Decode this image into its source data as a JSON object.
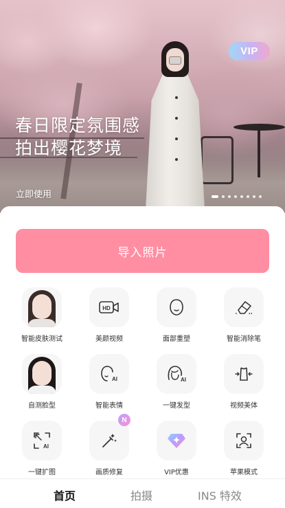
{
  "banner": {
    "title_line1": "春日限定氛围感",
    "title_line2": "拍出樱花梦境",
    "cta": "立即使用",
    "vip_label": "VIP",
    "slide_count": 8,
    "active_slide": 1
  },
  "main": {
    "import_label": "导入照片"
  },
  "tools": [
    {
      "label": "智能皮肤测试",
      "icon": "face-photo-avatar"
    },
    {
      "label": "美颜视频",
      "icon": "hd-video-icon"
    },
    {
      "label": "面部重塑",
      "icon": "face-outline-icon"
    },
    {
      "label": "智能消除笔",
      "icon": "eraser-icon"
    },
    {
      "label": "自测脸型",
      "icon": "face-photo-avatar"
    },
    {
      "label": "智能表情",
      "icon": "ai-face-icon"
    },
    {
      "label": "一键发型",
      "icon": "ai-hair-icon"
    },
    {
      "label": "视频美体",
      "icon": "body-reshape-icon"
    },
    {
      "label": "一键扩图",
      "icon": "ai-expand-icon"
    },
    {
      "label": "画质修复",
      "icon": "magic-wand-icon",
      "badge": "N"
    },
    {
      "label": "VIP优惠",
      "icon": "diamond-icon"
    },
    {
      "label": "苹果模式",
      "icon": "face-scan-icon"
    }
  ],
  "tabbar": {
    "tabs": [
      {
        "label": "首页",
        "active": true
      },
      {
        "label": "拍摄",
        "active": false
      },
      {
        "label": "INS 特效",
        "active": false
      }
    ]
  },
  "colors": {
    "accent": "#ff8ea3",
    "vip_gradient": [
      "#9fd8f7",
      "#c9b3f2",
      "#f2a7cf"
    ]
  }
}
